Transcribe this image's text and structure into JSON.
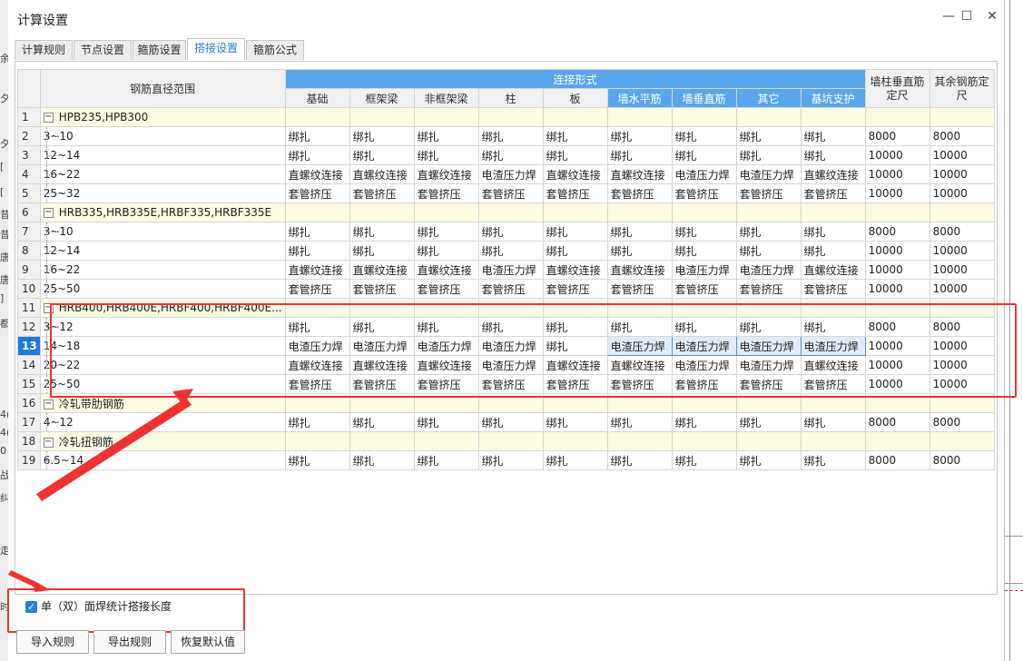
{
  "window": {
    "title": "计算设置",
    "min": "—",
    "max": "☐",
    "close": "✕"
  },
  "tabs": [
    {
      "label": "计算规则",
      "active": false
    },
    {
      "label": "节点设置",
      "active": false
    },
    {
      "label": "箍筋设置",
      "active": false
    },
    {
      "label": "搭接设置",
      "active": true
    },
    {
      "label": "箍筋公式",
      "active": false
    }
  ],
  "header": {
    "range": "钢筋直径范围",
    "group": "连接形式",
    "cols": [
      "基础",
      "框架梁",
      "非框架梁",
      "柱",
      "板",
      "墙水平筋",
      "墙垂直筋",
      "其它",
      "基坑支护"
    ],
    "extra1_line1": "墙柱垂直筋",
    "extra1_line2": "定尺",
    "extra2_line1": "其余钢筋定",
    "extra2_line2": "尺"
  },
  "rows": [
    {
      "n": "1",
      "group": true,
      "label": "HPB235,HPB300"
    },
    {
      "n": "2",
      "group": false,
      "label": "3~10",
      "vals": [
        "绑扎",
        "绑扎",
        "绑扎",
        "绑扎",
        "绑扎",
        "绑扎",
        "绑扎",
        "绑扎",
        "绑扎"
      ],
      "l1": "8000",
      "l2": "8000"
    },
    {
      "n": "3",
      "group": false,
      "label": "12~14",
      "vals": [
        "绑扎",
        "绑扎",
        "绑扎",
        "绑扎",
        "绑扎",
        "绑扎",
        "绑扎",
        "绑扎",
        "绑扎"
      ],
      "l1": "10000",
      "l2": "10000"
    },
    {
      "n": "4",
      "group": false,
      "label": "16~22",
      "vals": [
        "直螺纹连接",
        "直螺纹连接",
        "直螺纹连接",
        "电渣压力焊",
        "直螺纹连接",
        "直螺纹连接",
        "电渣压力焊",
        "电渣压力焊",
        "直螺纹连接"
      ],
      "l1": "10000",
      "l2": "10000"
    },
    {
      "n": "5",
      "group": false,
      "label": "25~32",
      "vals": [
        "套管挤压",
        "套管挤压",
        "套管挤压",
        "套管挤压",
        "套管挤压",
        "套管挤压",
        "套管挤压",
        "套管挤压",
        "套管挤压"
      ],
      "l1": "10000",
      "l2": "10000"
    },
    {
      "n": "6",
      "group": true,
      "label": "HRB335,HRB335E,HRBF335,HRBF335E"
    },
    {
      "n": "7",
      "group": false,
      "label": "3~10",
      "vals": [
        "绑扎",
        "绑扎",
        "绑扎",
        "绑扎",
        "绑扎",
        "绑扎",
        "绑扎",
        "绑扎",
        "绑扎"
      ],
      "l1": "8000",
      "l2": "8000"
    },
    {
      "n": "8",
      "group": false,
      "label": "12~14",
      "vals": [
        "绑扎",
        "绑扎",
        "绑扎",
        "绑扎",
        "绑扎",
        "绑扎",
        "绑扎",
        "绑扎",
        "绑扎"
      ],
      "l1": "10000",
      "l2": "10000"
    },
    {
      "n": "9",
      "group": false,
      "label": "16~22",
      "vals": [
        "直螺纹连接",
        "直螺纹连接",
        "直螺纹连接",
        "电渣压力焊",
        "直螺纹连接",
        "直螺纹连接",
        "电渣压力焊",
        "电渣压力焊",
        "直螺纹连接"
      ],
      "l1": "10000",
      "l2": "10000"
    },
    {
      "n": "10",
      "group": false,
      "label": "25~50",
      "vals": [
        "套管挤压",
        "套管挤压",
        "套管挤压",
        "套管挤压",
        "套管挤压",
        "套管挤压",
        "套管挤压",
        "套管挤压",
        "套管挤压"
      ],
      "l1": "10000",
      "l2": "10000"
    },
    {
      "n": "11",
      "group": true,
      "label": "HRB400,HRB400E,HRBF400,HRBF400E..."
    },
    {
      "n": "12",
      "group": false,
      "label": "3~12",
      "vals": [
        "绑扎",
        "绑扎",
        "绑扎",
        "绑扎",
        "绑扎",
        "绑扎",
        "绑扎",
        "绑扎",
        "绑扎"
      ],
      "l1": "8000",
      "l2": "8000"
    },
    {
      "n": "13",
      "group": false,
      "selected": true,
      "label": "14~18",
      "vals": [
        "电渣压力焊",
        "电渣压力焊",
        "电渣压力焊",
        "电渣压力焊",
        "绑扎",
        "电渣压力焊",
        "电渣压力焊",
        "电渣压力焊",
        "电渣压力焊"
      ],
      "l1": "10000",
      "l2": "10000"
    },
    {
      "n": "14",
      "group": false,
      "label": "20~22",
      "vals": [
        "直螺纹连接",
        "直螺纹连接",
        "直螺纹连接",
        "电渣压力焊",
        "直螺纹连接",
        "直螺纹连接",
        "电渣压力焊",
        "电渣压力焊",
        "直螺纹连接"
      ],
      "l1": "10000",
      "l2": "10000"
    },
    {
      "n": "15",
      "group": false,
      "label": "25~50",
      "vals": [
        "套管挤压",
        "套管挤压",
        "套管挤压",
        "套管挤压",
        "套管挤压",
        "套管挤压",
        "套管挤压",
        "套管挤压",
        "套管挤压"
      ],
      "l1": "10000",
      "l2": "10000"
    },
    {
      "n": "16",
      "group": true,
      "label": "冷轧带肋钢筋"
    },
    {
      "n": "17",
      "group": false,
      "label": "4~12",
      "vals": [
        "绑扎",
        "绑扎",
        "绑扎",
        "绑扎",
        "绑扎",
        "绑扎",
        "绑扎",
        "绑扎",
        "绑扎"
      ],
      "l1": "8000",
      "l2": "8000"
    },
    {
      "n": "18",
      "group": true,
      "label": "冷轧扭钢筋"
    },
    {
      "n": "19",
      "group": false,
      "label": "6.5~14",
      "vals": [
        "绑扎",
        "绑扎",
        "绑扎",
        "绑扎",
        "绑扎",
        "绑扎",
        "绑扎",
        "绑扎",
        "绑扎"
      ],
      "l1": "8000",
      "l2": "8000"
    }
  ],
  "checkbox": {
    "label": "单（双）面焊统计搭接长度",
    "checked": true
  },
  "buttons": {
    "import": "导入规则",
    "export": "导出规则",
    "restore": "恢复默认值"
  },
  "left_strip": [
    "余",
    "夕",
    "夕",
    "[",
    "[",
    "昔",
    "昔",
    "唐",
    "唐",
    "]",
    "都",
    "4(",
    "4(",
    "0",
    "战",
    "纠",
    "走",
    "时"
  ],
  "colors": {
    "accent": "#2a7fd6",
    "header_blue": "#5aa6ec",
    "annotation": "#e33333",
    "group_row": "#fdfbe4"
  }
}
